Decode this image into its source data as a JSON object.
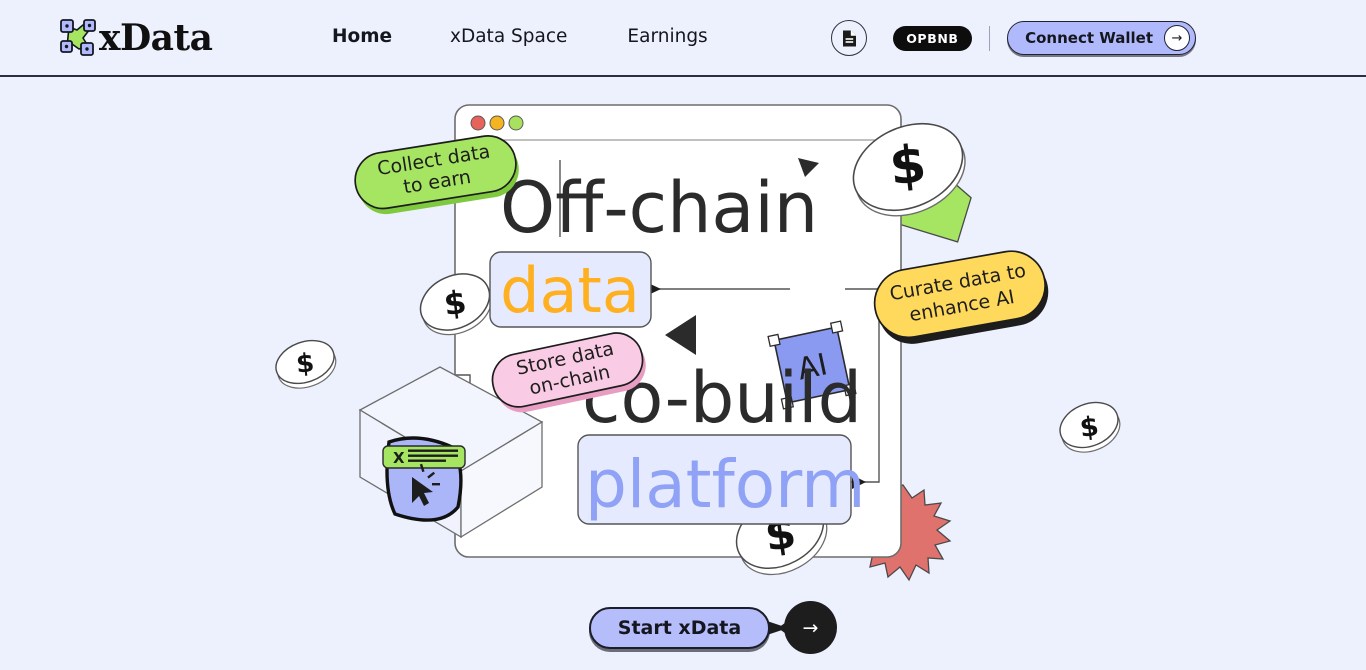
{
  "header": {
    "logo_text": "xData",
    "logo_icon": "xdata-node-graph-logo",
    "nav": [
      {
        "label": "Home",
        "active": true
      },
      {
        "label": "xData Space",
        "active": false
      },
      {
        "label": "Earnings",
        "active": false
      }
    ],
    "doc_icon": "document-icon",
    "chain_badge": "OPBNB",
    "connect_label": "Connect Wallet",
    "connect_arrow_icon": "arrow-right-icon"
  },
  "hero": {
    "headline_line1": "Off-chain",
    "headline_line2": "co-build",
    "box_data": "data",
    "box_platform": "platform",
    "node_ai": "AI",
    "tag_x": "X",
    "badges": [
      {
        "id": "collect",
        "line1": "Collect data",
        "line2": "to earn",
        "color": "#a5e561"
      },
      {
        "id": "store",
        "line1": "Store data",
        "line2": "on-chain",
        "color": "#f9cbe4"
      },
      {
        "id": "curate",
        "line1": "Curate data to",
        "line2": "enhance AI",
        "color": "#ffd95c"
      }
    ],
    "coin_symbol": "$",
    "coins_count": 5,
    "window_dots": [
      "#e8625c",
      "#f5b522",
      "#a8e05f"
    ],
    "cta_label": "Start xData",
    "cta_arrow_icon": "arrow-right-icon"
  },
  "colors": {
    "background": "#edf0fd",
    "accent_periwinkle": "#b0b9fb",
    "accent_orange": "#ffb020",
    "accent_green": "#a5e561",
    "accent_pink": "#f9cbe4",
    "accent_yellow": "#ffd95c",
    "accent_red": "#e0726e",
    "ink": "#15171f"
  }
}
